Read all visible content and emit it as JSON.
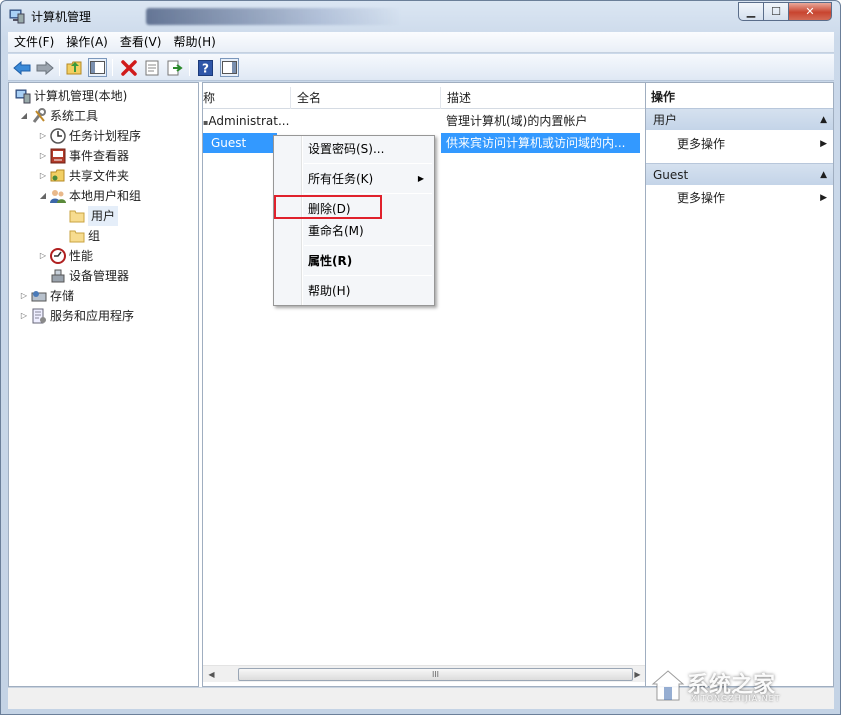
{
  "window": {
    "title": "计算机管理",
    "controls": {
      "minimize": "▁",
      "maximize": "☐",
      "close": "✕"
    }
  },
  "menubar": [
    {
      "label": "文件(F)"
    },
    {
      "label": "操作(A)"
    },
    {
      "label": "查看(V)"
    },
    {
      "label": "帮助(H)"
    }
  ],
  "toolbar": {
    "icons": [
      "back-arrow-icon",
      "forward-arrow-icon",
      "up-folder-icon",
      "show-hide-tree-icon",
      "delete-icon",
      "properties-icon",
      "export-list-icon",
      "help-icon",
      "show-hide-action-pane-icon"
    ]
  },
  "tree": {
    "items": [
      {
        "label": "计算机管理(本地)",
        "icon": "computer-management-icon"
      },
      {
        "label": "系统工具",
        "icon": "system-tools-icon"
      },
      {
        "label": "任务计划程序",
        "icon": "clock-icon"
      },
      {
        "label": "事件查看器",
        "icon": "event-viewer-icon"
      },
      {
        "label": "共享文件夹",
        "icon": "shared-folder-icon"
      },
      {
        "label": "本地用户和组",
        "icon": "users-group-icon"
      },
      {
        "label": "用户",
        "icon": "folder-icon"
      },
      {
        "label": "组",
        "icon": "folder-icon"
      },
      {
        "label": "性能",
        "icon": "performance-icon"
      },
      {
        "label": "设备管理器",
        "icon": "device-manager-icon"
      },
      {
        "label": "存储",
        "icon": "storage-icon"
      },
      {
        "label": "服务和应用程序",
        "icon": "services-icon"
      }
    ]
  },
  "list": {
    "columns": [
      "称",
      "全名",
      "描述"
    ],
    "rows": [
      {
        "name": "Administrat...",
        "fullname": "",
        "description": "管理计算机(域)的内置帐户"
      },
      {
        "name": "Guest",
        "fullname": "",
        "description": "供来宾访问计算机或访问域的内..."
      }
    ],
    "scroll_grip": "III"
  },
  "actions": {
    "title": "操作",
    "groups": [
      {
        "label": "用户",
        "items": [
          {
            "label": "更多操作"
          }
        ]
      },
      {
        "label": "Guest",
        "items": [
          {
            "label": "更多操作"
          }
        ]
      }
    ]
  },
  "context_menu": {
    "items": [
      {
        "label": "设置密码(S)..."
      },
      {
        "label": "所有任务(K)"
      },
      {
        "label": "删除(D)"
      },
      {
        "label": "重命名(M)"
      },
      {
        "label": "属性(R)"
      },
      {
        "label": "帮助(H)"
      }
    ]
  },
  "watermark": {
    "text": "系统之家",
    "sub": "XITONGZHIJIA.NET"
  },
  "colors": {
    "selection": "#3399ff",
    "highlight_box": "#e0212c",
    "group_header": "#c4d4e8"
  }
}
